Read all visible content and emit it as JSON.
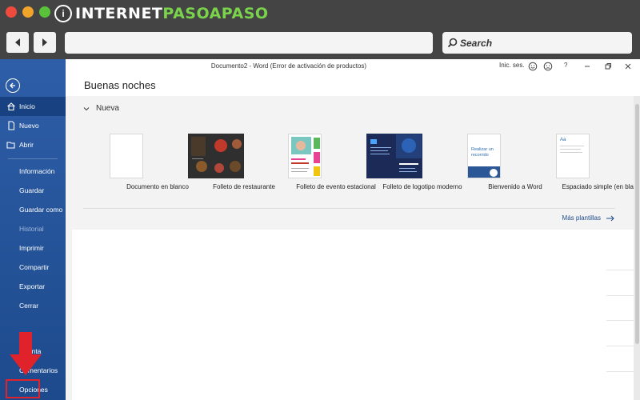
{
  "branding": {
    "logo_part1": "INTERNET",
    "logo_part2": "PASOAPASO",
    "badge": "i"
  },
  "browser": {
    "search_label": "Search",
    "url_value": ""
  },
  "word": {
    "window_title": "Documento2 - Word (Error de activación de productos)",
    "sign_in": "Inic. ses.",
    "help": "?",
    "greeting": "Buenas noches",
    "new_section": "Nuevo",
    "section_header": "Nueva",
    "more_templates": "Más plantillas"
  },
  "sidebar": {
    "items": [
      {
        "label": "Inicio",
        "icon": "home-icon",
        "selected": true
      },
      {
        "label": "Nuevo",
        "icon": "new-document-icon"
      },
      {
        "label": "Abrir",
        "icon": "folder-open-icon"
      },
      {
        "label": "Información"
      },
      {
        "label": "Guardar"
      },
      {
        "label": "Guardar como"
      },
      {
        "label": "Historial",
        "disabled": true
      },
      {
        "label": "Imprimir"
      },
      {
        "label": "Compartir"
      },
      {
        "label": "Exportar"
      },
      {
        "label": "Cerrar"
      },
      {
        "label": "Cuenta"
      },
      {
        "label": "Comentarios"
      },
      {
        "label": "Opciones"
      }
    ]
  },
  "templates": [
    {
      "label": "Documento en blanco"
    },
    {
      "label": "Folleto de restaurante"
    },
    {
      "label": "Folleto de evento estacional"
    },
    {
      "label": "Folleto de logotipo moderno"
    },
    {
      "label": "Bienvenido a Word",
      "thumb_text": "Realizar un recorrido"
    },
    {
      "label": "Espaciado simple (en blanco)",
      "thumb_text": "Aa"
    }
  ],
  "colors": {
    "sidebar_blue": "#2b5797",
    "accent_link": "#1e4e8c",
    "annotation_red": "#e0232a",
    "logo_green": "#7ad34b"
  }
}
